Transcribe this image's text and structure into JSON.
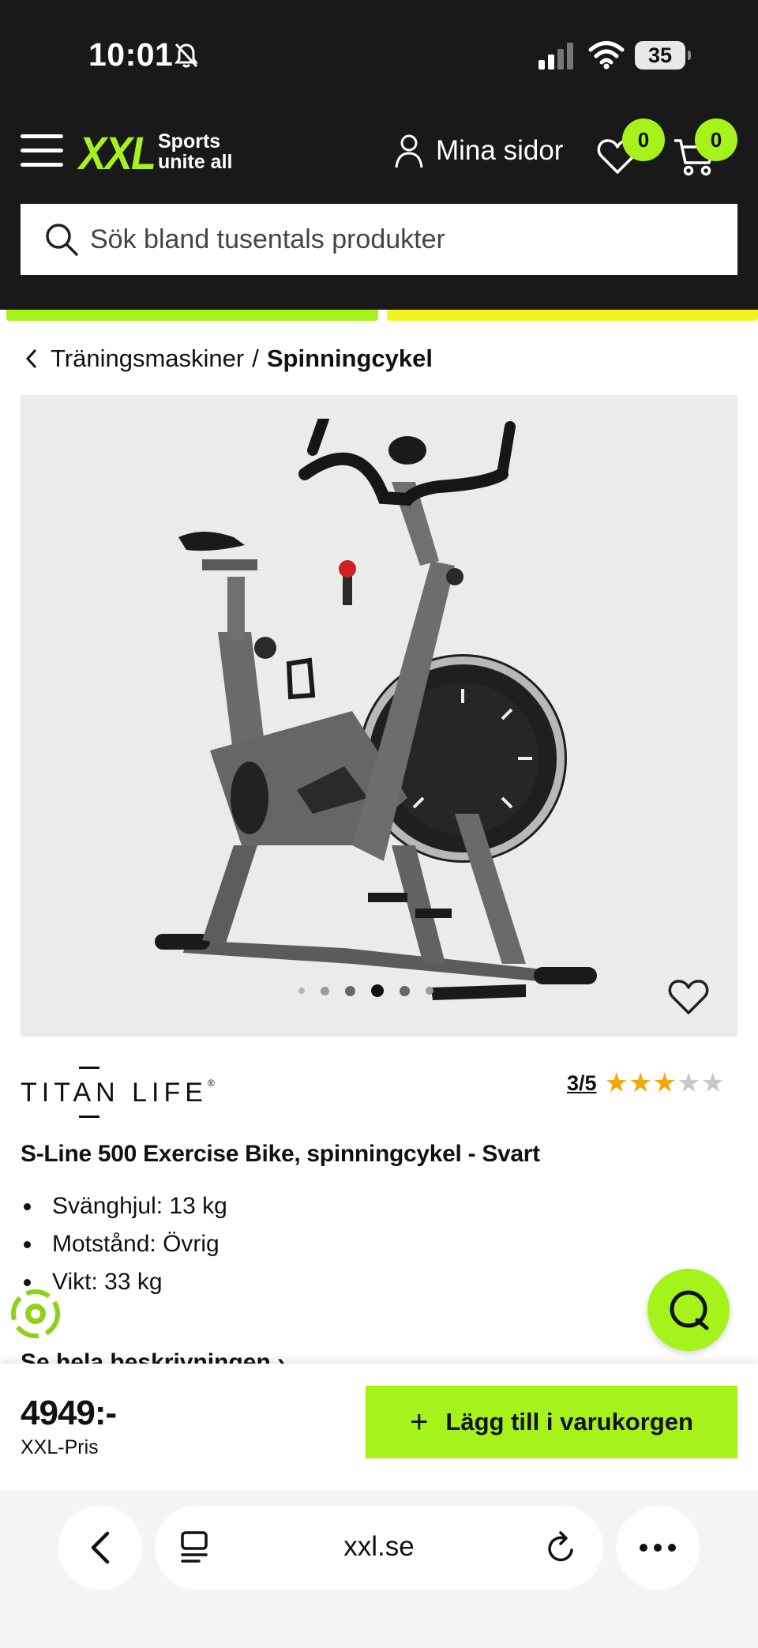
{
  "status_bar": {
    "time": "10:01",
    "battery": "35"
  },
  "header": {
    "logo_text": "XXL",
    "tagline_line1": "Sports",
    "tagline_line2": "unite all",
    "account_label": "Mina sidor",
    "wishlist_count": "0",
    "cart_count": "0",
    "search_placeholder": "Sök bland tusentals produkter",
    "accent_color": "#a6f21b"
  },
  "breadcrumb": {
    "parent": "Träningsmaskiner",
    "separator": "/",
    "current": "Spinningcykel"
  },
  "gallery": {
    "image_count": 6,
    "active_index": 3
  },
  "product": {
    "brand": "TITAN LIFE",
    "brand_reg": "®",
    "rating_text": "3/5",
    "rating_value": 3,
    "rating_max": 5,
    "title": "S-Line 500 Exercise Bike, spinningcykel - Svart",
    "specs": [
      "Svänghjul: 13 kg",
      "Motstånd: Övrig",
      "Vikt: 33 kg"
    ],
    "more_link": "Se hela beskrivningen ›"
  },
  "buy_bar": {
    "price": "4949:-",
    "price_label": "XXL-Pris",
    "add_button_icon": "+",
    "add_button_label": "Lägg till i varukorgen"
  },
  "browser": {
    "url": "xxl.se"
  }
}
